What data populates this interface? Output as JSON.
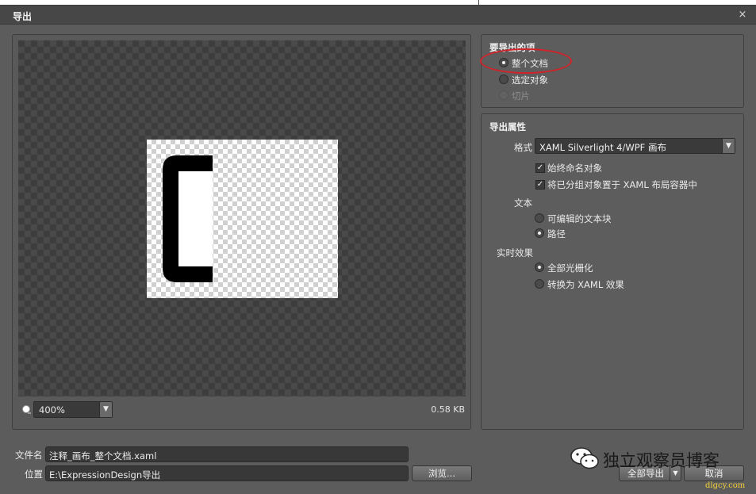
{
  "dialog": {
    "title": "导出",
    "close_glyph": "×"
  },
  "preview": {
    "zoom_value": "400%",
    "file_size": "0.58 KB"
  },
  "export_items": {
    "title": "要导出的项",
    "options": [
      {
        "label": "整个文档",
        "selected": true,
        "enabled": true
      },
      {
        "label": "选定对象",
        "selected": false,
        "enabled": true
      },
      {
        "label": "切片",
        "selected": false,
        "enabled": false
      }
    ]
  },
  "export_props": {
    "title": "导出属性",
    "format_label": "格式",
    "format_value": "XAML Silverlight 4/WPF 画布",
    "checks": [
      {
        "label": "始终命名对象",
        "checked": true
      },
      {
        "label": "将已分组对象置于 XAML 布局容器中",
        "checked": true
      }
    ],
    "text_section": "文本",
    "text_options": [
      {
        "label": "可编辑的文本块",
        "selected": false
      },
      {
        "label": "路径",
        "selected": true
      }
    ],
    "effects_section": "实时效果",
    "effects_options": [
      {
        "label": "全部光栅化",
        "selected": true
      },
      {
        "label": "转换为 XAML 效果",
        "selected": false
      }
    ]
  },
  "bottom": {
    "filename_label": "文件名",
    "filename_value": "注释_画布_整个文档.xaml",
    "location_label": "位置",
    "location_value": "E:\\ExpressionDesign导出",
    "browse_label": "浏览...",
    "export_all_label": "全部导出",
    "cancel_label": "取消"
  },
  "watermark": {
    "text": "独立观察员博客",
    "url": "dlgcy.com"
  },
  "colors": {
    "annotation": "#d0232a",
    "dialog_bg": "#5c5c5c"
  }
}
